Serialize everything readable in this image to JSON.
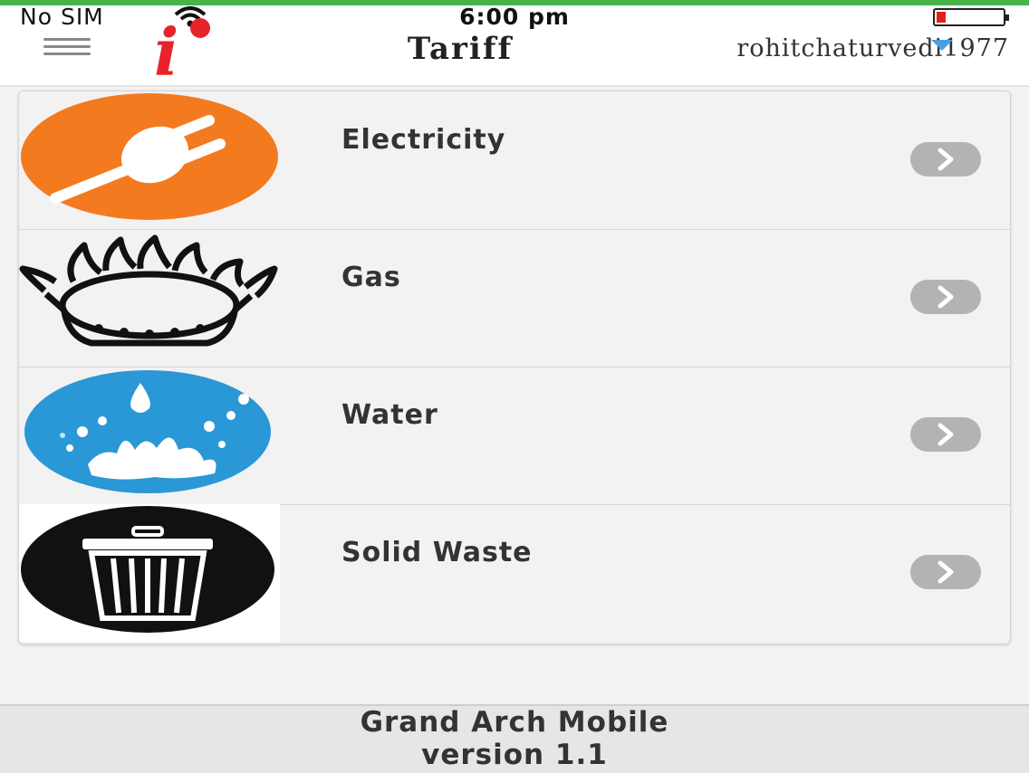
{
  "status_bar": {
    "carrier": "No SIM",
    "time": "6:00 pm"
  },
  "header": {
    "logo_letter": "i",
    "title": "Tariff",
    "username": "rohitchaturvedi1977"
  },
  "tariff_items": [
    {
      "label": "Electricity",
      "icon": "electric-plug-icon",
      "color": "#f47a20"
    },
    {
      "label": "Gas",
      "icon": "gas-burner-icon",
      "color": "#111111"
    },
    {
      "label": "Water",
      "icon": "water-splash-icon",
      "color": "#2a97d6"
    },
    {
      "label": "Solid Waste",
      "icon": "trash-bin-icon",
      "color": "#111111"
    }
  ],
  "footer": {
    "line1": "Grand Arch Mobile",
    "line2": "version 1.1"
  },
  "colors": {
    "top_strip": "#46b449",
    "logo": "#e8232a",
    "chevron": "#b3b3b3"
  }
}
